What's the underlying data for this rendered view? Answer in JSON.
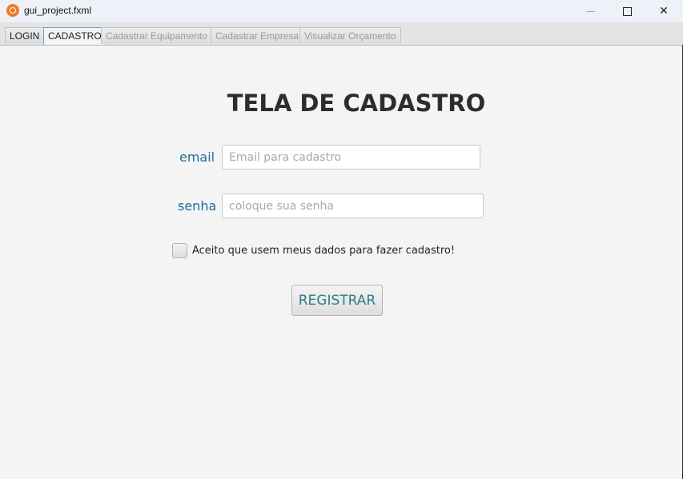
{
  "window": {
    "title": "gui_project.fxml",
    "icon": "app-icon",
    "controls": {
      "minimize": "—",
      "close": "✕"
    }
  },
  "tabs": [
    {
      "label": "LOGIN",
      "enabled": true,
      "active": false
    },
    {
      "label": "CADASTRO",
      "enabled": true,
      "active": true
    },
    {
      "label": "Cadastrar Equipamento",
      "enabled": false,
      "active": false
    },
    {
      "label": "Cadastrar Empresa",
      "enabled": false,
      "active": false
    },
    {
      "label": "Visualizar Orçamento",
      "enabled": false,
      "active": false
    }
  ],
  "form": {
    "heading": "TELA DE CADASTRO",
    "email_label": "email",
    "email_placeholder": "Email para cadastro",
    "email_value": "",
    "senha_label": "senha",
    "senha_placeholder": "coloque sua senha",
    "senha_value": "",
    "consent_label": "Aceito que usem meus dados para fazer cadastro!",
    "consent_checked": false,
    "register_label": "REGISTRAR"
  },
  "colors": {
    "label_blue": "#1e6b9a",
    "button_text": "#2a7f88",
    "active_tab_border": "#5fa8d3"
  }
}
